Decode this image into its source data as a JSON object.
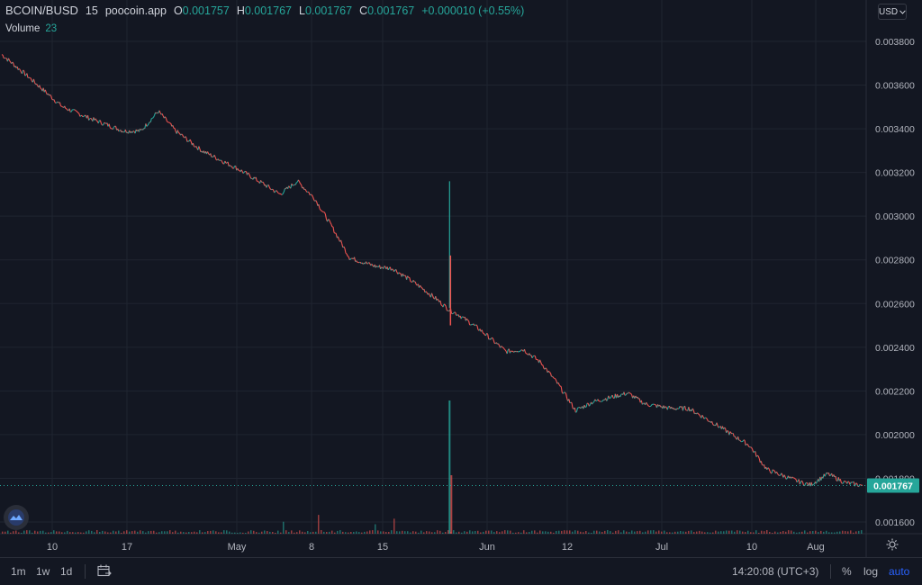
{
  "header": {
    "symbol": "BCOIN/BUSD",
    "interval": "15",
    "source": "poocoin.app",
    "open_label": "O",
    "open": "0.001757",
    "high_label": "H",
    "high": "0.001767",
    "low_label": "L",
    "low": "0.001767",
    "close_label": "C",
    "close": "0.001767",
    "change": "+0.000010 (+0.55%)"
  },
  "volume_legend": {
    "label": "Volume",
    "value": "23"
  },
  "currency_button": {
    "label": "USD",
    "icon": "chevron-down-icon"
  },
  "bottom_bar": {
    "timeframes": [
      "1m",
      "1w",
      "1d"
    ],
    "calendar_icon": "calendar-range-icon",
    "clock": "14:20:08 (UTC+3)",
    "options": [
      "%",
      "log",
      "auto"
    ],
    "active_option": "auto"
  },
  "colors": {
    "background": "#131722",
    "grid": "#1f2430",
    "up": "#26a69a",
    "down": "#ef5350",
    "price_tag": "#26a69a",
    "text": "#d1d4dc"
  },
  "chart_data": {
    "type": "line",
    "title": "BCOIN/BUSD",
    "xlabel": "",
    "ylabel": "",
    "grid": true,
    "x_tick_labels": [
      "10",
      "17",
      "May",
      "8",
      "15",
      "Jun",
      "12",
      "Jul",
      "10",
      "Aug"
    ],
    "y_tick_labels": [
      "0.003800",
      "0.003600",
      "0.003400",
      "0.003200",
      "0.003000",
      "0.002800",
      "0.002600",
      "0.002400",
      "0.002200",
      "0.002000",
      "0.001800",
      "0.001600"
    ],
    "ylim": [
      0.00155,
      0.00388
    ],
    "current_price": "0.001767",
    "series": [
      {
        "values": [
          [
            0.0,
            0.00374
          ],
          [
            3.0,
            0.00364
          ],
          [
            5.0,
            0.00357
          ],
          [
            7.0,
            0.0035
          ],
          [
            10.0,
            0.00345
          ],
          [
            14.0,
            0.00339
          ],
          [
            16.0,
            0.00339
          ],
          [
            18.0,
            0.00348
          ],
          [
            20.0,
            0.00339
          ],
          [
            23.0,
            0.0033
          ],
          [
            25.0,
            0.00326
          ],
          [
            27.0,
            0.00322
          ],
          [
            30.0,
            0.00315
          ],
          [
            32.0,
            0.0031
          ],
          [
            34.0,
            0.00316
          ],
          [
            36.0,
            0.00308
          ],
          [
            38.0,
            0.00295
          ],
          [
            40.0,
            0.00281
          ],
          [
            43.0,
            0.00277
          ],
          [
            45.0,
            0.00276
          ],
          [
            48.0,
            0.00268
          ],
          [
            50.0,
            0.00262
          ],
          [
            51.5,
            0.00257
          ],
          [
            52.5,
            0.00255
          ],
          [
            55.0,
            0.00248
          ],
          [
            58.0,
            0.00238
          ],
          [
            60.0,
            0.00239
          ],
          [
            62.0,
            0.00233
          ],
          [
            64.0,
            0.00223
          ],
          [
            66.0,
            0.00211
          ],
          [
            68.0,
            0.00215
          ],
          [
            70.0,
            0.00217
          ],
          [
            72.0,
            0.00219
          ],
          [
            74.0,
            0.00214
          ],
          [
            77.0,
            0.00212
          ],
          [
            79.0,
            0.00212
          ],
          [
            82.0,
            0.00205
          ],
          [
            84.0,
            0.002
          ],
          [
            86.0,
            0.00195
          ],
          [
            88.0,
            0.00184
          ],
          [
            90.0,
            0.00181
          ],
          [
            92.0,
            0.00178
          ],
          [
            93.0,
            0.00177
          ],
          [
            95.0,
            0.00182
          ],
          [
            97.0,
            0.00178
          ],
          [
            99.0,
            0.001767
          ]
        ]
      }
    ],
    "volume_spikes": [
      {
        "x": 51.5,
        "price_high": 0.00316,
        "volume_level": 0.95
      }
    ]
  }
}
